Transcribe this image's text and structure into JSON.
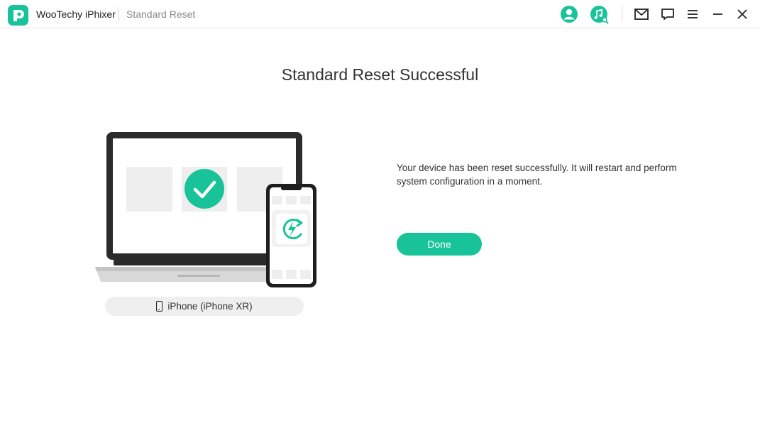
{
  "app": {
    "name": "WooTechy iPhixer",
    "mode": "Standard Reset"
  },
  "toolbar": {
    "icons": [
      "user-account-icon",
      "music-search-icon",
      "mail-icon",
      "feedback-icon",
      "menu-icon",
      "minimize-icon",
      "close-icon"
    ]
  },
  "main": {
    "title": "Standard Reset Successful",
    "message": "Your device has been reset successfully. It will restart and perform system configuration in a moment.",
    "done_label": "Done",
    "device_label": "iPhone (iPhone XR)"
  },
  "colors": {
    "accent": "#19c39a",
    "icon_dark": "#222222"
  }
}
